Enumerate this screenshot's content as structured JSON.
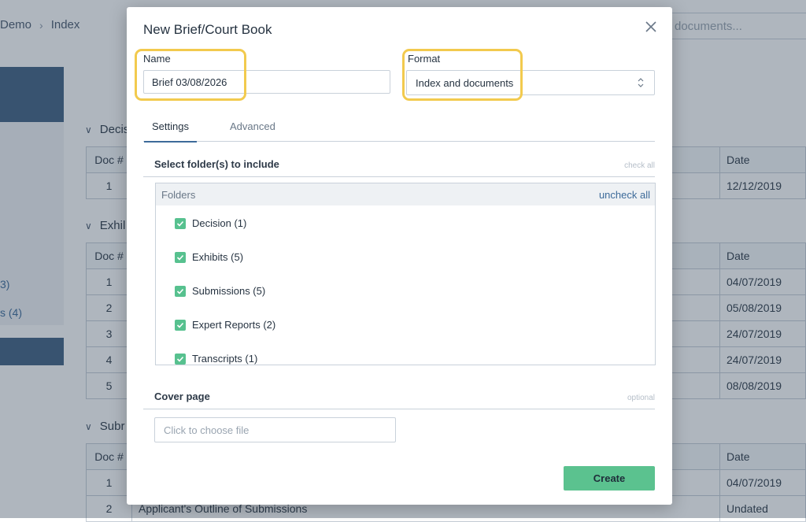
{
  "background": {
    "breadcrumb": [
      "Demo",
      "Index"
    ],
    "search_placeholder": "documents...",
    "sidebar_counts": [
      "3)",
      "s (4)"
    ],
    "sections": [
      {
        "label": "Decis",
        "header": {
          "doc": "Doc #",
          "date": "Date"
        },
        "rows": [
          {
            "num": "1",
            "title": "",
            "date": "12/12/2019"
          }
        ]
      },
      {
        "label": "Exhil",
        "header": {
          "doc": "Doc #",
          "date": "Date"
        },
        "rows": [
          {
            "num": "1",
            "title": "",
            "date": "04/07/2019"
          },
          {
            "num": "2",
            "title": "",
            "date": "05/08/2019"
          },
          {
            "num": "3",
            "title": "",
            "date": "24/07/2019"
          },
          {
            "num": "4",
            "title": "",
            "date": "24/07/2019"
          },
          {
            "num": "5",
            "title": "",
            "date": "08/08/2019"
          }
        ]
      },
      {
        "label": "Subr",
        "header": {
          "doc": "Doc #",
          "date": "Date"
        },
        "rows": [
          {
            "num": "1",
            "title": "",
            "date": "04/07/2019"
          },
          {
            "num": "2",
            "title": "Applicant's Outline of Submissions",
            "date": "Undated"
          }
        ]
      }
    ]
  },
  "modal": {
    "title": "New Brief/Court Book",
    "name_label": "Name",
    "name_value": "Brief 03/08/2026",
    "format_label": "Format",
    "format_value": "Index and documents",
    "tabs": [
      "Settings",
      "Advanced"
    ],
    "folders_section": {
      "title": "Select folder(s) to include",
      "action": "check all"
    },
    "folders_box": {
      "header": "Folders",
      "action": "uncheck all",
      "items": [
        {
          "label": "Decision (1)",
          "checked": true
        },
        {
          "label": "Exhibits (5)",
          "checked": true
        },
        {
          "label": "Submissions (5)",
          "checked": true
        },
        {
          "label": "Expert Reports (2)",
          "checked": true
        },
        {
          "label": "Transcripts (1)",
          "checked": true
        }
      ]
    },
    "cover_section": {
      "title": "Cover page",
      "note": "optional"
    },
    "file_placeholder": "Click to choose file",
    "create_label": "Create"
  },
  "colors": {
    "accent": "#3d6b9a",
    "create_button": "#5bc28f",
    "checkbox": "#57c18f",
    "highlight": "#f2ca4e"
  }
}
